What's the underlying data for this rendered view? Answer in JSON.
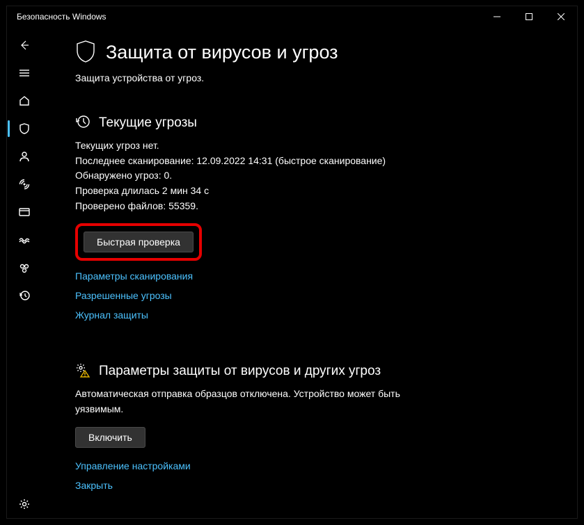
{
  "titlebar": {
    "title": "Безопасность Windows"
  },
  "page": {
    "title": "Защита от вирусов и угроз",
    "subtitle": "Защита устройства от угроз."
  },
  "threats": {
    "title": "Текущие угрозы",
    "status": "Текущих угроз нет.",
    "last_scan": "Последнее сканирование: 12.09.2022 14:31 (быстрое сканирование)",
    "found": "Обнаружено угроз: 0.",
    "duration": "Проверка длилась 2 мин 34 с",
    "files": "Проверено файлов: 55359.",
    "quick_scan_btn": "Быстрая проверка",
    "link_scan_options": "Параметры сканирования",
    "link_allowed": "Разрешенные угрозы",
    "link_history": "Журнал защиты"
  },
  "settings": {
    "title": "Параметры защиты от вирусов и других угроз",
    "warning": "Автоматическая отправка образцов отключена. Устройство может быть уязвимым.",
    "enable_btn": "Включить",
    "link_manage": "Управление настройками",
    "link_close": "Закрыть"
  }
}
